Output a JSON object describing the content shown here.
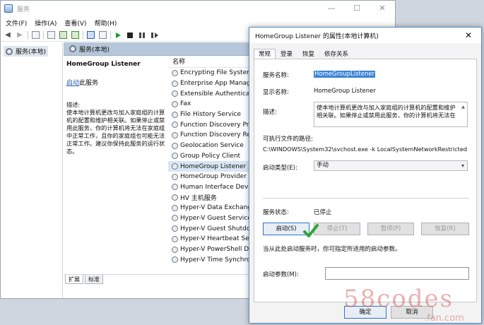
{
  "main_window": {
    "title": "服务",
    "controls": {
      "minimize": "—",
      "maximize": "☐",
      "close": "✕"
    },
    "menu": [
      "文件(F)",
      "操作(A)",
      "查看(V)",
      "帮助(H)"
    ],
    "tree_item": "服务(本地)",
    "content_header": "服务(本地)",
    "detail": {
      "service_title": "HomeGroup Listener",
      "action_link": "启动",
      "action_suffix": "此服务",
      "desc_label": "描述:",
      "description": "使本地计算机更改与加入家庭组的计算机的配置和维护相关联。如果停止或禁用此服务，你的计算机将无法在家庭组中正常工作，且你的家庭组也可能无法正常工作。建议你保持此服务的运行状态。"
    },
    "list": {
      "column": "名称",
      "rows": [
        "Encrypting File System (E",
        "Enterprise App Manage",
        "Extensible Authenticatio",
        "Fax",
        "File History Service",
        "Function Discovery Prov",
        "Function Discovery Reso",
        "Geolocation Service",
        "Group Policy Client",
        "HomeGroup Listener",
        "HomeGroup Provider",
        "Human Interface Device",
        "HV 主机服务",
        "Hyper-V Data Exchange",
        "Hyper-V Guest Service I",
        "Hyper-V Guest Shutdow",
        "Hyper-V Heartbeat Serv",
        "Hyper-V PowerShell Dire",
        "Hyper-V Time Synchron"
      ],
      "selected_index": 9
    },
    "bottom_tabs": [
      "扩展",
      "标准"
    ]
  },
  "dialog": {
    "title": "HomeGroup Listener 的属性(本地计算机)",
    "close": "✕",
    "tabs": [
      "常规",
      "登录",
      "恢复",
      "依存关系"
    ],
    "service_name_label": "服务名称:",
    "service_name": "HomeGroupListener",
    "display_name_label": "显示名称:",
    "display_name": "HomeGroup Listener",
    "desc_label": "描述:",
    "description": "使本地计算机更改与加入家庭组的计算机的配置和维护相关联。如果停止或禁用此服务，你的计算机将无法在",
    "path_label": "可执行文件的路径:",
    "path": "C:\\WINDOWS\\System32\\svchost.exe -k LocalSystemNetworkRestricted",
    "startup_type_label": "启动类型(E):",
    "startup_type": "手动",
    "status_label": "服务状态:",
    "status": "已停止",
    "buttons": {
      "start": "启动(S)",
      "stop": "停止(T)",
      "pause": "暂停(P)",
      "resume": "恢复(R)"
    },
    "hint": "当从此处启动服务时，你可指定所适用的启动参数。",
    "param_label": "启动参数(M):",
    "ok": "确定",
    "cancel": "取消"
  },
  "colors": {
    "accent": "#3b83d6",
    "check": "#2fa33a",
    "header": "#b6c7d9"
  }
}
